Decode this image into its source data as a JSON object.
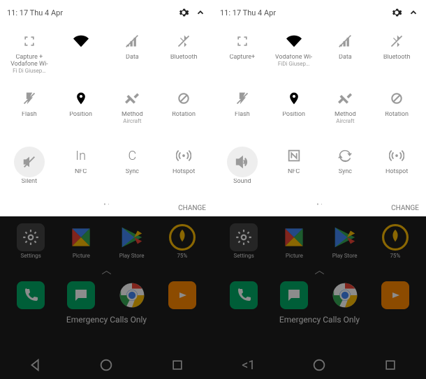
{
  "panels": [
    {
      "status": {
        "time": "11: 17 Thu 4 Apr"
      },
      "tiles": [
        {
          "key": "capture-wifi",
          "icon": "expand",
          "label": "Capture + Vodafone Wi-",
          "sub": "Fi Di Giusep…",
          "active": false
        },
        {
          "key": "wifi",
          "icon": "wifi",
          "label": "",
          "sub": "",
          "active": true
        },
        {
          "key": "data",
          "icon": "signal",
          "label": "Data",
          "sub": "",
          "active": false
        },
        {
          "key": "bluetooth",
          "icon": "bluetooth",
          "label": "Bluetooth",
          "sub": "",
          "active": false
        },
        {
          "key": "flash",
          "icon": "flash",
          "label": "Flash",
          "sub": "",
          "active": false
        },
        {
          "key": "position",
          "icon": "location",
          "label": "Position",
          "sub": "",
          "active": true
        },
        {
          "key": "method",
          "icon": "tools",
          "label": "Method",
          "sub": "Aircraft",
          "active": false
        },
        {
          "key": "rotation",
          "icon": "rotation",
          "label": "Rotation",
          "sub": "",
          "active": false
        },
        {
          "key": "silent",
          "icon": "mute",
          "label": "Silent",
          "sub": "",
          "bubble": true,
          "active": false
        },
        {
          "key": "nfc",
          "icon": "nfc-text",
          "label": "NFC",
          "sub": "",
          "active": false,
          "text": "In"
        },
        {
          "key": "sync",
          "icon": "sync-text",
          "label": "Sync",
          "sub": "",
          "active": false,
          "text": "C"
        },
        {
          "key": "hotspot",
          "icon": "hotspot",
          "label": "Hotspot",
          "sub": "",
          "active": false
        }
      ],
      "pager": "• ·",
      "change": "CHANGE",
      "apps": {
        "row1": [
          {
            "key": "settings",
            "label": "Settings",
            "icon": "gear-app",
            "bg": "#444"
          },
          {
            "key": "photos",
            "label": "Picture",
            "icon": "pinwheel",
            "bg": "transparent"
          },
          {
            "key": "playstore",
            "label": "Play Store",
            "icon": "play",
            "bg": "transparent"
          },
          {
            "key": "boost",
            "label": "75%",
            "icon": "rocket",
            "bg": "transparent"
          }
        ],
        "dock": [
          {
            "key": "phone",
            "icon": "phone",
            "bg": "#0a6"
          },
          {
            "key": "messages",
            "icon": "message",
            "bg": "#0a6"
          },
          {
            "key": "chrome",
            "icon": "chrome",
            "bg": "transparent"
          },
          {
            "key": "music",
            "icon": "music",
            "bg": "#f80"
          }
        ]
      },
      "emergency": "Emergency Calls Only",
      "nav": [
        "back-tri",
        "home-circle",
        "recent-square"
      ]
    },
    {
      "status": {
        "time": "11: 17 Thu 4 Apr"
      },
      "tiles": [
        {
          "key": "capture",
          "icon": "expand",
          "label": "Capture+",
          "sub": "",
          "active": false
        },
        {
          "key": "wifi2",
          "icon": "wifi",
          "label": "Vodafone Wi-",
          "sub": "FiDi Giusep…",
          "active": true
        },
        {
          "key": "data",
          "icon": "signal",
          "label": "Data",
          "sub": "",
          "active": false
        },
        {
          "key": "bluetooth",
          "icon": "bluetooth",
          "label": "Bluetooth",
          "sub": "",
          "active": false
        },
        {
          "key": "flash",
          "icon": "flash",
          "label": "Flash",
          "sub": "",
          "active": false
        },
        {
          "key": "position",
          "icon": "location",
          "label": "Position",
          "sub": "",
          "active": true
        },
        {
          "key": "method",
          "icon": "tools",
          "label": "Method",
          "sub": "Aircraft",
          "active": false
        },
        {
          "key": "rotation",
          "icon": "rotation",
          "label": "Rotation",
          "sub": "",
          "active": false
        },
        {
          "key": "sound",
          "icon": "speaker",
          "label": "Sound",
          "sub": "",
          "bubble": true,
          "active": false
        },
        {
          "key": "nfc",
          "icon": "nfc",
          "label": "NFC",
          "sub": "",
          "active": false
        },
        {
          "key": "sync",
          "icon": "sync",
          "label": "Sync",
          "sub": "",
          "active": false
        },
        {
          "key": "hotspot",
          "icon": "hotspot",
          "label": "Hotspot",
          "sub": "",
          "active": false
        }
      ],
      "pager": "• ·",
      "change": "CHANGE",
      "apps": {
        "row1": [
          {
            "key": "settings",
            "label": "Settings",
            "icon": "gear-app",
            "bg": "#444"
          },
          {
            "key": "photos",
            "label": "Picture",
            "icon": "pinwheel",
            "bg": "transparent"
          },
          {
            "key": "playstore",
            "label": "Play Store",
            "icon": "play",
            "bg": "transparent"
          },
          {
            "key": "boost",
            "label": "75%",
            "icon": "rocket",
            "bg": "transparent"
          }
        ],
        "dock": [
          {
            "key": "phone",
            "icon": "phone",
            "bg": "#0a6"
          },
          {
            "key": "messages",
            "icon": "message",
            "bg": "#0a6"
          },
          {
            "key": "chrome",
            "icon": "chrome",
            "bg": "transparent"
          },
          {
            "key": "music",
            "icon": "music",
            "bg": "#f80"
          }
        ]
      },
      "emergency": "Emergency Calls Only",
      "nav": [
        "back-num",
        "home-circle",
        "recent-square"
      ]
    }
  ]
}
